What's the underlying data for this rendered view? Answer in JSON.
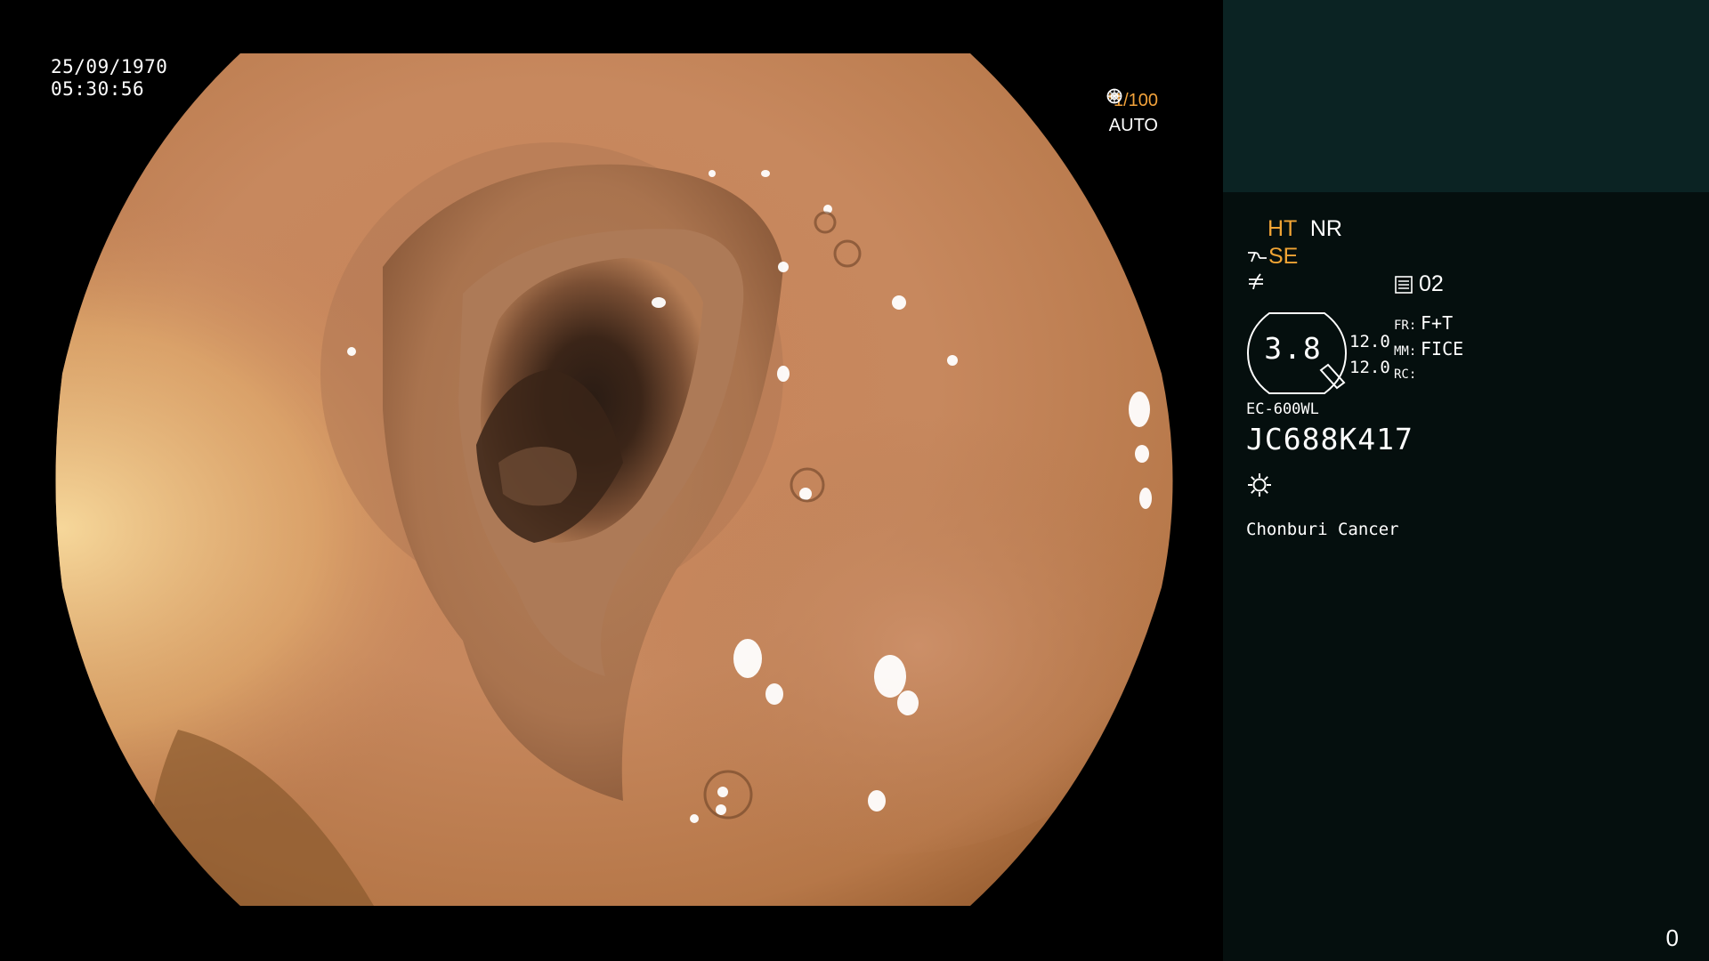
{
  "image": {
    "date": "25/09/1970",
    "time": "05:30:56",
    "shutter": "*1/100",
    "shutter_icon": "aperture-icon",
    "iris_mode": "AUTO",
    "iris_icon": "iris-icon"
  },
  "panel": {
    "ht": "HT",
    "nr": "NR",
    "se": "SE",
    "se_icon": "scope-tip-icon",
    "f_icon": "not-equal-icon",
    "channel_icon": "memory-icon",
    "channel": "02",
    "gauge_value": "3.8",
    "val_1": "12.0",
    "val_2": "12.0",
    "fr_label": "FR:",
    "fr_value": "F+T",
    "mm_label": "MM:",
    "mm_value": "FICE",
    "rc_label": "RC:",
    "rc_value": "",
    "model": "EC-600WL",
    "serial": "JC688K417",
    "light_icon": "light-source-icon",
    "institution": "Chonburi Cancer",
    "counter": "0"
  },
  "colors": {
    "background": "#000000",
    "panel_top": "#0b2323",
    "panel": "#050f0e",
    "highlight": "#f0a434",
    "text": "#ffffff"
  }
}
